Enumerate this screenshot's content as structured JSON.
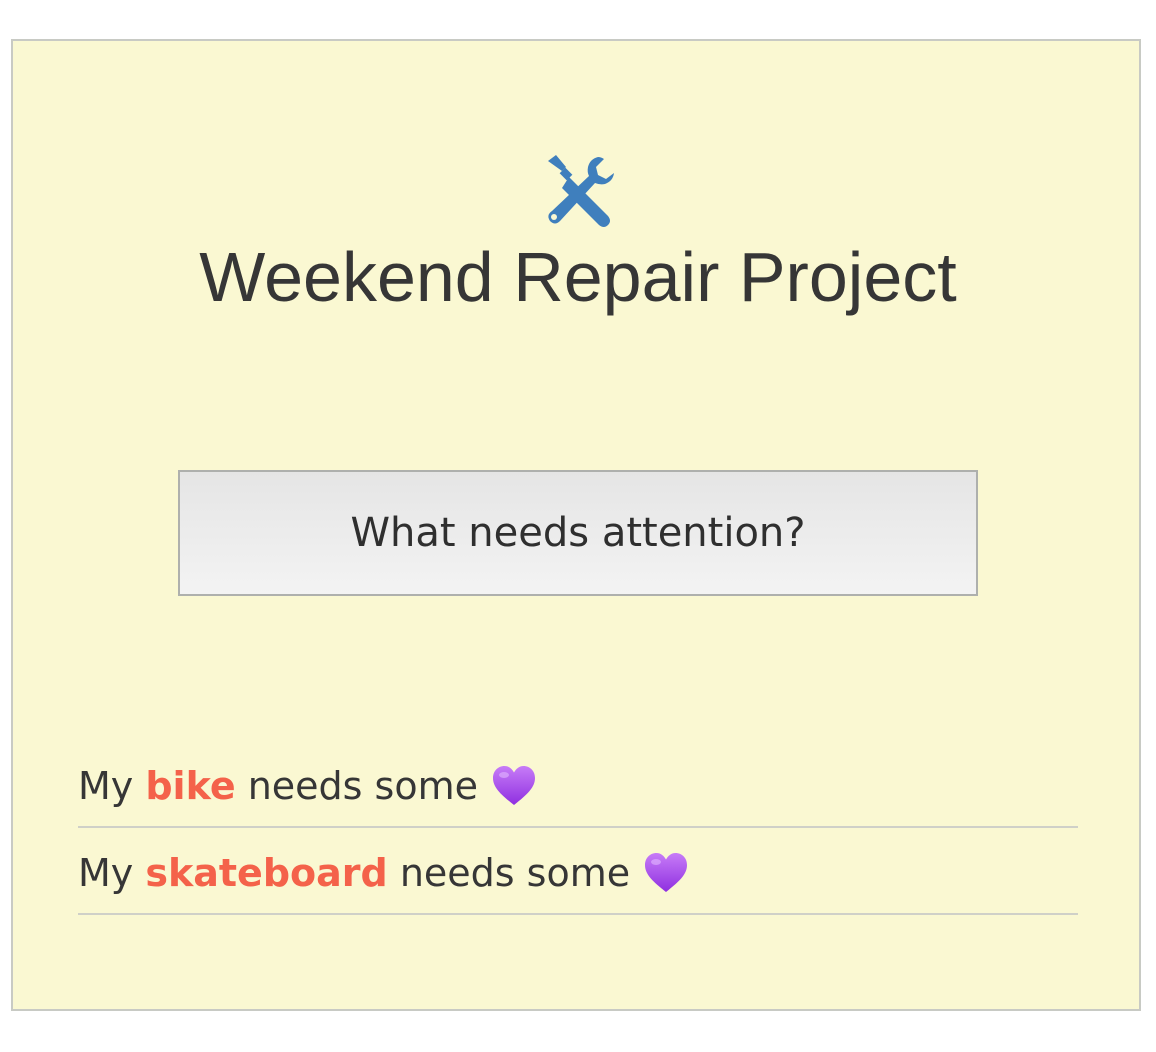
{
  "app": {
    "title": "Weekend Repair Project",
    "header_icon": "tools-icon",
    "prompt_button_label": "What needs attention?"
  },
  "repairs": [
    {
      "prefix": "My ",
      "item": "bike",
      "suffix": " needs some",
      "emoji": "purple-heart-icon"
    },
    {
      "prefix": "My ",
      "item": "skateboard",
      "suffix": " needs some",
      "emoji": "purple-heart-icon"
    }
  ],
  "colors": {
    "card_background": "#faf8d2",
    "accent_item": "#f4624a",
    "icon_blue": "#3f7fbd",
    "heart_purple": "#a347f0",
    "text": "#363636"
  }
}
